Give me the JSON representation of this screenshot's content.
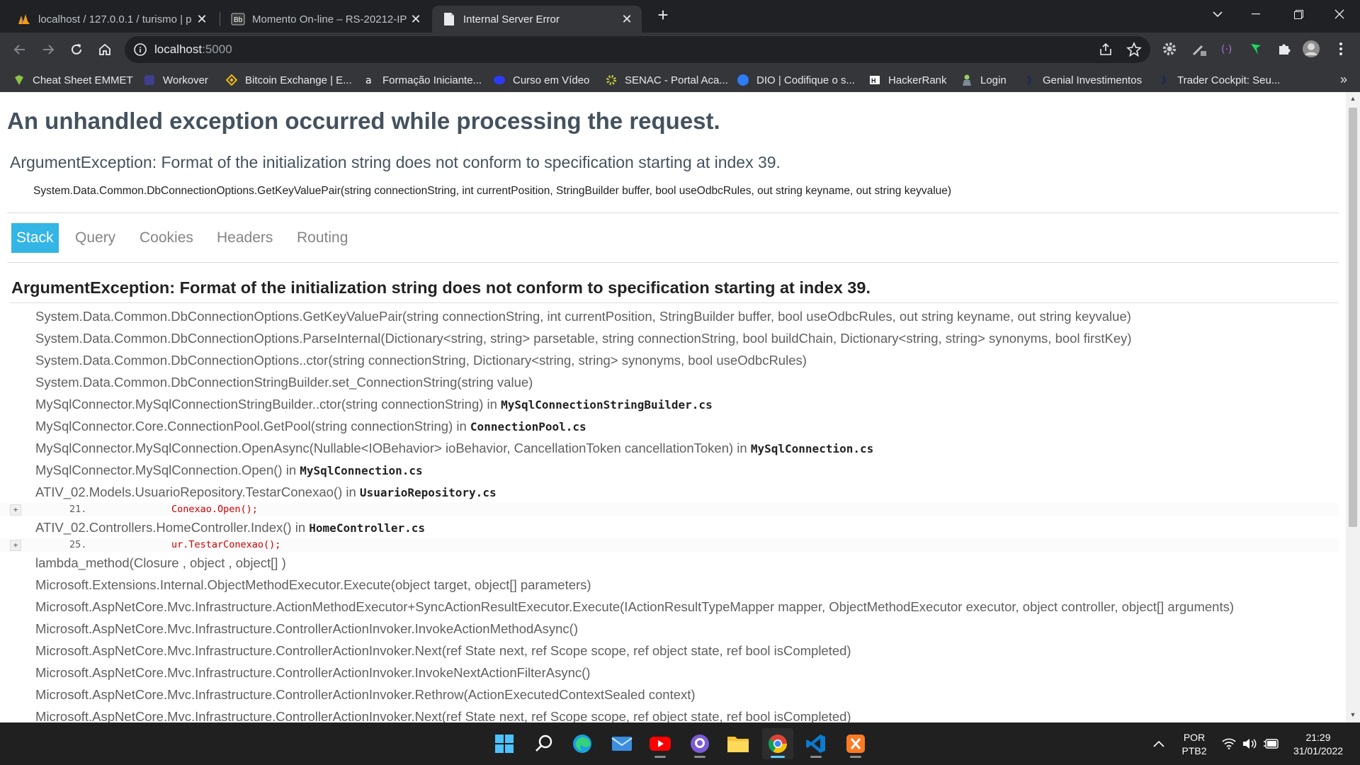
{
  "browser": {
    "tabs": [
      {
        "title": "localhost / 127.0.0.1 / turismo | p",
        "icon": "phpmyadmin-icon"
      },
      {
        "title": "Momento On-line – RS-20212-IP",
        "icon": "blackboard-icon"
      },
      {
        "title": "Internal Server Error",
        "icon": "page-icon",
        "active": true
      }
    ],
    "new_tab": "+",
    "url_host": "localhost",
    "url_port": ":5000",
    "bookmarks": [
      "Cheat Sheet EMMET",
      "Workover",
      "Bitcoin Exchange | E...",
      "Formação Iniciante...",
      "Curso em Vídeo",
      "SENAC - Portal Aca...",
      "DIO | Codifique o s...",
      "HackerRank",
      "Login",
      "Genial Investimentos",
      "Trader Cockpit: Seu..."
    ],
    "bookmarks_more": "»"
  },
  "page": {
    "title": "An unhandled exception occurred while processing the request.",
    "error": "ArgumentException: Format of the initialization string does not conform to specification starting at index 39.",
    "location": "System.Data.Common.DbConnectionOptions.GetKeyValuePair(string connectionString, int currentPosition, StringBuilder buffer, bool useOdbcRules, out string keyname, out string keyvalue)",
    "nav": [
      "Stack",
      "Query",
      "Cookies",
      "Headers",
      "Routing"
    ],
    "stack_title": "ArgumentException: Format of the initialization string does not conform to specification starting at index 39.",
    "frames": [
      {
        "method": "System.Data.Common.DbConnectionOptions.GetKeyValuePair(string connectionString, int currentPosition, StringBuilder buffer, bool useOdbcRules, out string keyname, out string keyvalue)"
      },
      {
        "method": "System.Data.Common.DbConnectionOptions.ParseInternal(Dictionary<string, string> parsetable, string connectionString, bool buildChain, Dictionary<string, string> synonyms, bool firstKey)"
      },
      {
        "method": "System.Data.Common.DbConnectionOptions..ctor(string connectionString, Dictionary<string, string> synonyms, bool useOdbcRules)"
      },
      {
        "method": "System.Data.Common.DbConnectionStringBuilder.set_ConnectionString(string value)"
      },
      {
        "method": "MySqlConnector.MySqlConnectionStringBuilder..ctor(string connectionString)",
        "in": " in ",
        "file": "MySqlConnectionStringBuilder.cs"
      },
      {
        "method": "MySqlConnector.Core.ConnectionPool.GetPool(string connectionString)",
        "in": " in ",
        "file": "ConnectionPool.cs"
      },
      {
        "method": "MySqlConnector.MySqlConnection.OpenAsync(Nullable<IOBehavior> ioBehavior, CancellationToken cancellationToken)",
        "in": " in ",
        "file": "MySqlConnection.cs"
      },
      {
        "method": "MySqlConnector.MySqlConnection.Open()",
        "in": " in ",
        "file": "MySqlConnection.cs"
      },
      {
        "method": "ATIV_02.Models.UsuarioRepository.TestarConexao()",
        "in": " in ",
        "file": "UsuarioRepository.cs",
        "source": {
          "expander": "+",
          "line": "21.",
          "code": "Conexao.Open();"
        }
      },
      {
        "method": "ATIV_02.Controllers.HomeController.Index()",
        "in": " in ",
        "file": "HomeController.cs",
        "source": {
          "expander": "+",
          "line": "25.",
          "code": "ur.TestarConexao();"
        }
      },
      {
        "method": "lambda_method(Closure , object , object[] )"
      },
      {
        "method": "Microsoft.Extensions.Internal.ObjectMethodExecutor.Execute(object target, object[] parameters)"
      },
      {
        "method": "Microsoft.AspNetCore.Mvc.Infrastructure.ActionMethodExecutor+SyncActionResultExecutor.Execute(IActionResultTypeMapper mapper, ObjectMethodExecutor executor, object controller, object[] arguments)"
      },
      {
        "method": "Microsoft.AspNetCore.Mvc.Infrastructure.ControllerActionInvoker.InvokeActionMethodAsync()"
      },
      {
        "method": "Microsoft.AspNetCore.Mvc.Infrastructure.ControllerActionInvoker.Next(ref State next, ref Scope scope, ref object state, ref bool isCompleted)"
      },
      {
        "method": "Microsoft.AspNetCore.Mvc.Infrastructure.ControllerActionInvoker.InvokeNextActionFilterAsync()"
      },
      {
        "method": "Microsoft.AspNetCore.Mvc.Infrastructure.ControllerActionInvoker.Rethrow(ActionExecutedContextSealed context)"
      },
      {
        "method": "Microsoft.AspNetCore.Mvc.Infrastructure.ControllerActionInvoker.Next(ref State next, ref Scope scope, ref object state, ref bool isCompleted)"
      }
    ]
  },
  "taskbar": {
    "apps": [
      "start-icon",
      "search-icon",
      "edge-icon",
      "mail-icon",
      "youtube-icon",
      "github-icon",
      "file-explorer-icon",
      "chrome-icon",
      "vscode-icon",
      "xampp-icon"
    ],
    "language": "POR",
    "layout": "PTB2",
    "time": "21:29",
    "date": "31/01/2022"
  },
  "colors": {
    "accent": "#33b5e5",
    "title": "#44525e",
    "code_red": "#cc0000",
    "chrome_dark": "#202124",
    "chrome_toolbar": "#35363a",
    "taskbar": "#202020"
  }
}
